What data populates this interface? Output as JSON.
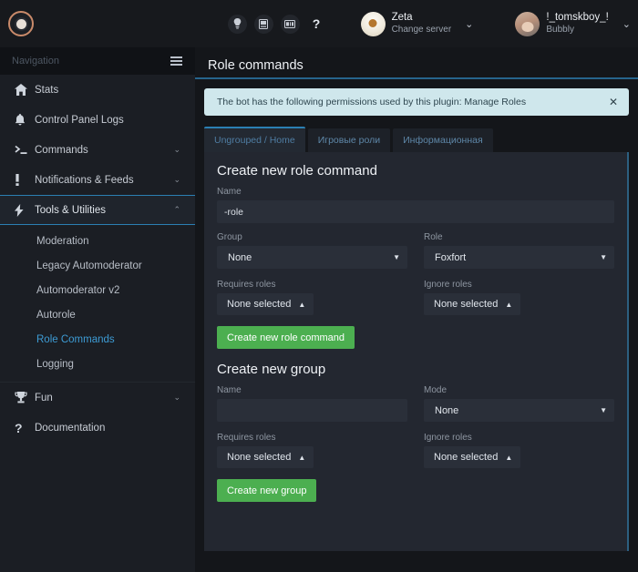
{
  "topbar": {
    "brand_icon": "bot-logo-icon",
    "icons": [
      {
        "name": "lightbulb-icon",
        "label": "Tips"
      },
      {
        "name": "server-icon",
        "label": "Servers"
      },
      {
        "name": "card-icon",
        "label": "Premium"
      },
      {
        "name": "question-mark-icon",
        "label": "?"
      }
    ],
    "server": {
      "name": "Zeta",
      "sub": "Change server",
      "chevron": "⌄"
    },
    "user": {
      "name": "!_tomskboy_!",
      "sub": "Bubbly",
      "chevron": "⌄"
    }
  },
  "sidebar": {
    "header_label": "Navigation",
    "items": [
      {
        "label": "Stats",
        "icon": "home-icon",
        "caret": ""
      },
      {
        "label": "Control Panel Logs",
        "icon": "bell-icon",
        "caret": ""
      },
      {
        "label": "Commands",
        "icon": "terminal-icon",
        "caret": "⌄"
      },
      {
        "label": "Notifications & Feeds",
        "icon": "exclamation-icon",
        "caret": "⌄"
      },
      {
        "label": "Tools & Utilities",
        "icon": "lightning-bolt-icon",
        "caret": "⌃"
      }
    ],
    "subitems": [
      {
        "label": "Moderation"
      },
      {
        "label": "Legacy Automoderator"
      },
      {
        "label": "Automoderator v2"
      },
      {
        "label": "Autorole"
      },
      {
        "label": "Role Commands"
      },
      {
        "label": "Logging"
      }
    ],
    "items_bottom": [
      {
        "label": "Fun",
        "icon": "trophy-icon",
        "caret": "⌄"
      },
      {
        "label": "Documentation",
        "icon": "question-mark-icon",
        "caret": ""
      }
    ]
  },
  "main": {
    "page_title": "Role commands",
    "alert": {
      "message": "The bot has the following permissions used by this plugin: Manage Roles",
      "close_icon": "close-icon"
    },
    "tabs": [
      {
        "label": "Ungrouped / Home"
      },
      {
        "label": "Игровые роли"
      },
      {
        "label": "Информационная"
      }
    ],
    "role_command_form": {
      "title": "Create new role command",
      "name_label": "Name",
      "name_value": "-role",
      "group_label": "Group",
      "group_value": "None",
      "role_label": "Role",
      "role_value": "Foxfort",
      "requires_roles_label": "Requires roles",
      "requires_roles_value": "None selected",
      "ignore_roles_label": "Ignore roles",
      "ignore_roles_value": "None selected",
      "submit_label": "Create new role command"
    },
    "group_form": {
      "title": "Create new group",
      "name_label": "Name",
      "name_value": "",
      "name_placeholder": "",
      "mode_label": "Mode",
      "mode_value": "None",
      "requires_roles_label": "Requires roles",
      "requires_roles_value": "None selected",
      "ignore_roles_label": "Ignore roles",
      "ignore_roles_value": "None selected",
      "submit_label": "Create new group"
    }
  },
  "colors": {
    "accent_blue": "#2b7fb3",
    "link_blue": "#3d9bd4",
    "green": "#4caf50",
    "alert_bg": "#cfe7ec",
    "panel_bg": "#232730",
    "sidebar_bg": "#1b1e24"
  }
}
